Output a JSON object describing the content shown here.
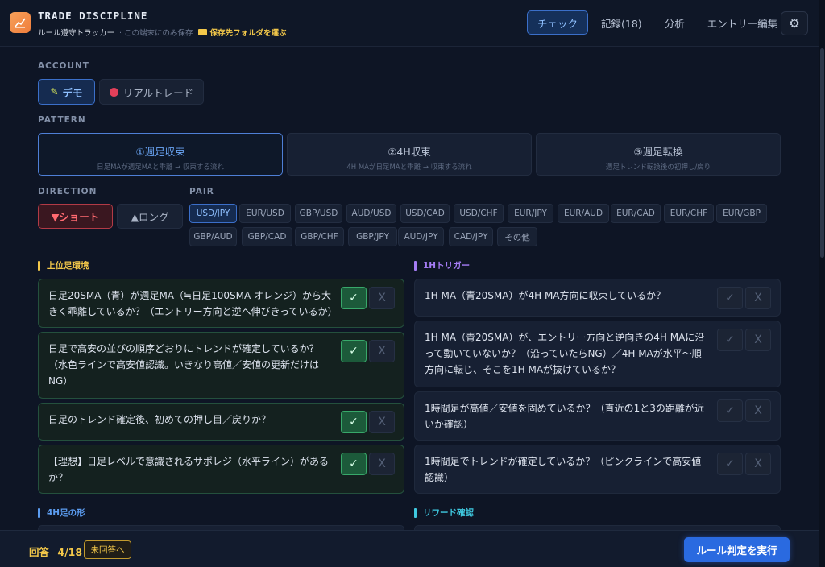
{
  "header": {
    "title": "TRADE DISCIPLINE",
    "subtitle": "ルール遵守トラッカー",
    "local_note": "· この端末にのみ保存",
    "folder_link": "保存先フォルダを選ぶ",
    "nav": [
      {
        "label": "チェック",
        "active": true
      },
      {
        "label": "記録(18)",
        "active": false
      },
      {
        "label": "分析",
        "active": false
      },
      {
        "label": "エントリー編集",
        "active": false
      }
    ],
    "gear_icon": "gear-icon"
  },
  "account": {
    "label": "ACCOUNT",
    "demo": "デモ",
    "real": "リアルトレード"
  },
  "pattern": {
    "label": "PATTERN",
    "items": [
      {
        "title": "①週足収束",
        "sub": "日足MAが週足MAと乖離 → 収束する流れ",
        "active": true
      },
      {
        "title": "②4H収束",
        "sub": "4H MAが日足MAと乖離 → 収束する流れ",
        "active": false
      },
      {
        "title": "③週足転換",
        "sub": "週足トレンド転換後の初押し/戻り",
        "active": false
      }
    ]
  },
  "direction": {
    "label": "DIRECTION",
    "short": "▼ショート",
    "long": "▲ロング"
  },
  "pair": {
    "label": "PAIR",
    "items": [
      "USD/JPY",
      "EUR/USD",
      "GBP/USD",
      "AUD/USD",
      "USD/CAD",
      "USD/CHF",
      "EUR/JPY",
      "EUR/AUD",
      "EUR/CAD",
      "EUR/CHF",
      "EUR/GBP",
      "GBP/AUD",
      "GBP/CAD",
      "GBP/CHF",
      "GBP/JPY",
      "AUD/JPY",
      "CAD/JPY",
      "その他"
    ],
    "selected": "USD/JPY"
  },
  "groups": {
    "left_title": "上位足環境",
    "left_items": [
      {
        "text": "日足20SMA（青）が週足MA（≒日足100SMA オレンジ）から大きく乖離しているか？（エントリー方向と逆へ伸びきっているか）",
        "checked": true
      },
      {
        "text": "日足で高安の並びの順序どおりにトレンドが確定しているか？（水色ラインで高安値認識。いきなり高値／安値の更新だけはNG）",
        "checked": true
      },
      {
        "text": "日足のトレンド確定後、初めての押し目／戻りか？",
        "checked": true
      },
      {
        "text": "【理想】日足レベルで意識されるサポレジ（水平ライン）があるか？",
        "checked": true
      }
    ],
    "right_title": "1Hトリガー",
    "right_items": [
      {
        "text": "1H MA（青20SMA）が4H MA方向に収束しているか？",
        "checked": false
      },
      {
        "text": "1H MA（青20SMA）が、エントリー方向と逆向きの4H MAに沿って動いていないか？（沿っていたらNG）／4H MAが水平〜順方向に転じ、そこを1H MAが抜けているか？",
        "checked": false
      },
      {
        "text": "1時間足が高値／安値を固めているか？（直近の1と3の距離が近いか確認）",
        "checked": false
      },
      {
        "text": "1時間足でトレンドが確定しているか？（ピンクラインで高安値認識）",
        "checked": false
      }
    ],
    "next_left": "4H足の形",
    "next_right": "リワード確認",
    "check_mark": "✓",
    "cross_mark": "X"
  },
  "colors": {
    "accent_blue": "#3b6fc9",
    "group_left": "#f3c84a",
    "group_right": "#a57cf5",
    "group_4h": "#5b9cf0",
    "group_reward": "#3fc9e0"
  },
  "footer": {
    "answer_label": "回答",
    "answer_count": "4/18",
    "unanswered": "未回答へ",
    "run": "ルール判定を実行"
  }
}
